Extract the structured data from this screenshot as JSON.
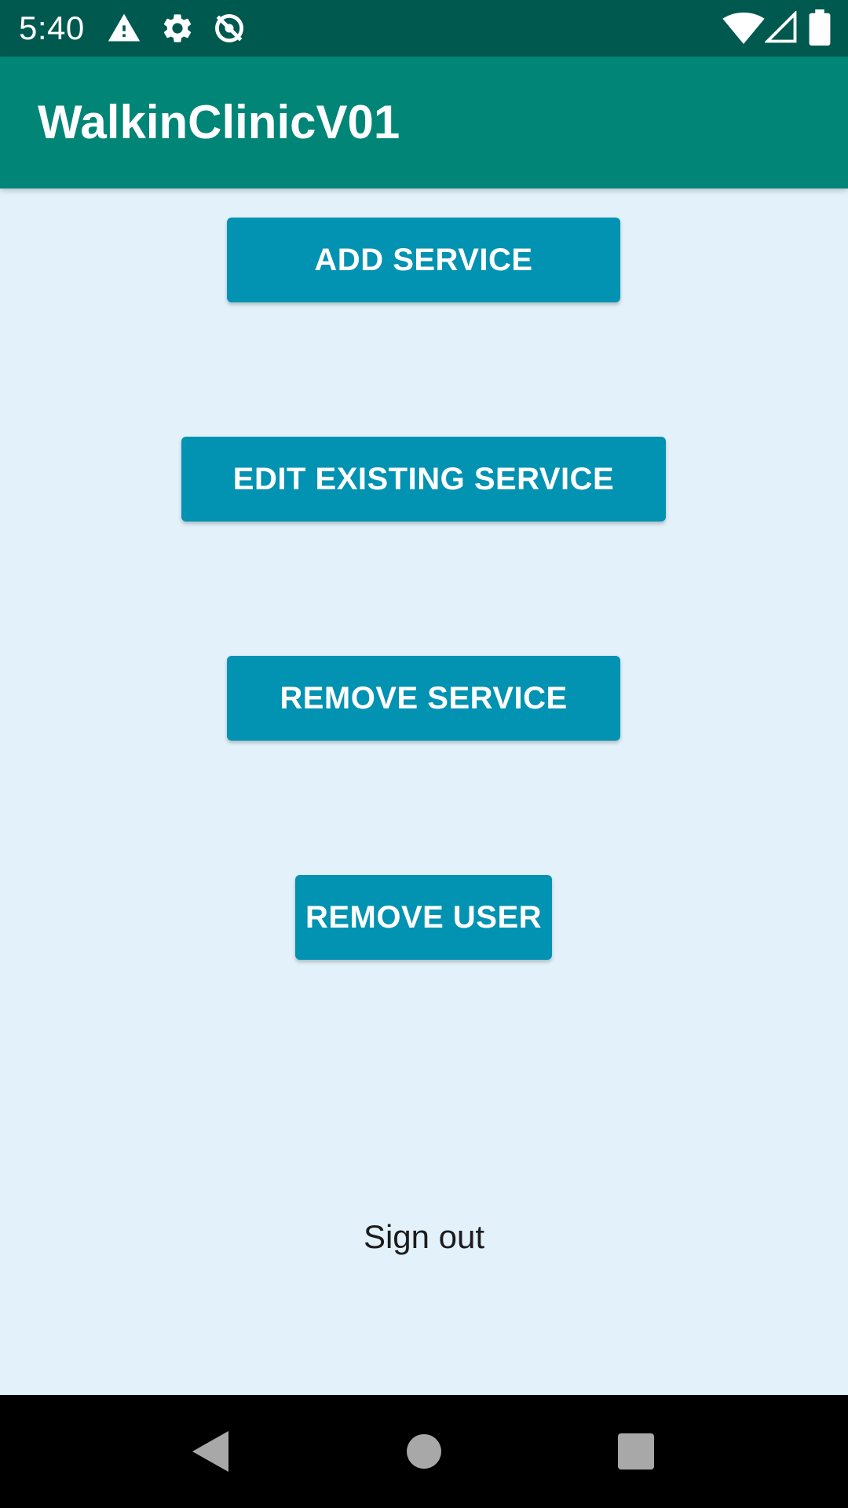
{
  "status_bar": {
    "time": "5:40",
    "icons": [
      "warning-icon",
      "gear-icon",
      "sync-off-icon",
      "wifi-icon",
      "cell-signal-icon",
      "battery-icon"
    ]
  },
  "app_bar": {
    "title": "WalkinClinicV01"
  },
  "main": {
    "buttons": [
      {
        "label": "ADD SERVICE"
      },
      {
        "label": "EDIT EXISTING SERVICE"
      },
      {
        "label": "REMOVE SERVICE"
      },
      {
        "label": "REMOVE USER"
      }
    ],
    "sign_out_label": "Sign out"
  },
  "nav_bar": {
    "icons": [
      "back-icon",
      "home-icon",
      "recents-icon"
    ]
  },
  "colors": {
    "status_bar": "#00594f",
    "app_bar": "#008577",
    "button": "#0292b2",
    "background": "#e2f1fa",
    "nav_bar": "#000000"
  }
}
